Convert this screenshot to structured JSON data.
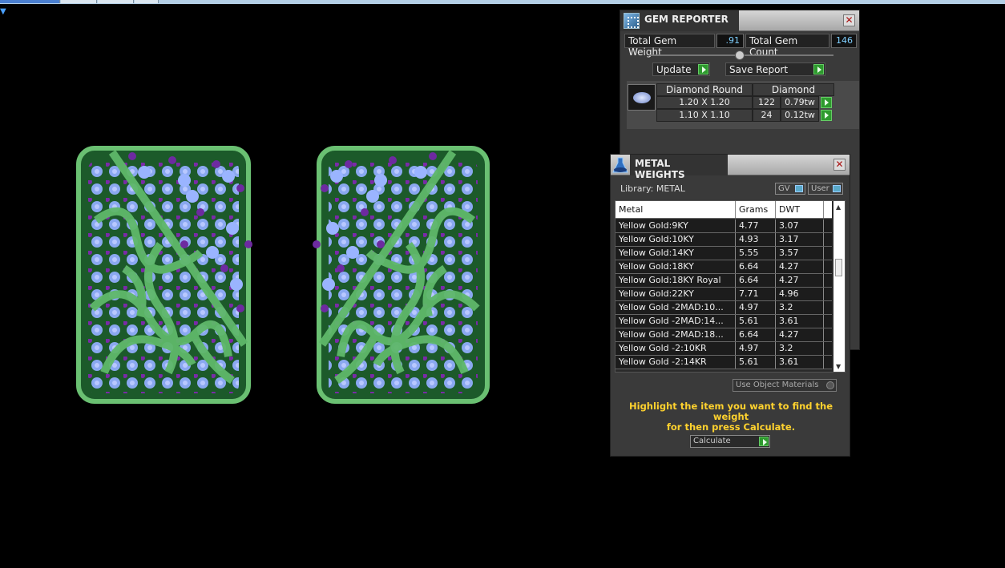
{
  "colors": {
    "metal_green": "#5fb86a",
    "gem_blue": "#8aa8f0",
    "gem_purple": "#7a2aa8",
    "hint_yellow": "#ffd22e",
    "value_cyan": "#7fd0ff"
  },
  "gem_reporter": {
    "title": "GEM REPORTER",
    "icon": "gem-reporter-icon",
    "total_weight_label": "Total Gem Weight",
    "total_weight_value": ".91",
    "total_count_label": "Total Gem Count",
    "total_count_value": "146",
    "update_label": "Update",
    "save_report_label": "Save Report",
    "table": {
      "col1": "Diamond Round",
      "col2": "Diamond",
      "rows": [
        {
          "size": "1.20 X 1.20",
          "count": "122",
          "weight": "0.79tw"
        },
        {
          "size": "1.10 X 1.10",
          "count": "24",
          "weight": "0.12tw"
        }
      ]
    }
  },
  "metal_weights": {
    "title": "METAL WEIGHTS",
    "library_label": "Library: METAL",
    "gv_label": "GV",
    "user_label": "User",
    "columns": [
      "Metal",
      "Grams",
      "DWT"
    ],
    "rows": [
      [
        "Yellow Gold:9KY",
        "4.77",
        "3.07"
      ],
      [
        "Yellow Gold:10KY",
        "4.93",
        "3.17"
      ],
      [
        "Yellow Gold:14KY",
        "5.55",
        "3.57"
      ],
      [
        "Yellow Gold:18KY",
        "6.64",
        "4.27"
      ],
      [
        "Yellow Gold:18KY Royal",
        "6.64",
        "4.27"
      ],
      [
        "Yellow Gold:22KY",
        "7.71",
        "4.96"
      ],
      [
        "Yellow Gold -2MAD:10...",
        "4.97",
        "3.2"
      ],
      [
        "Yellow Gold -2MAD:14...",
        "5.61",
        "3.61"
      ],
      [
        "Yellow Gold -2MAD:18...",
        "6.64",
        "4.27"
      ],
      [
        "Yellow Gold -2:10KR",
        "4.97",
        "3.2"
      ],
      [
        "Yellow Gold -2:14KR",
        "5.61",
        "3.61"
      ]
    ],
    "use_object_materials_label": "Use Object Materials",
    "hint_line1": "Highlight the item you want to find the weight",
    "hint_line2": "for then press Calculate.",
    "calculate_label": "Calculate"
  }
}
